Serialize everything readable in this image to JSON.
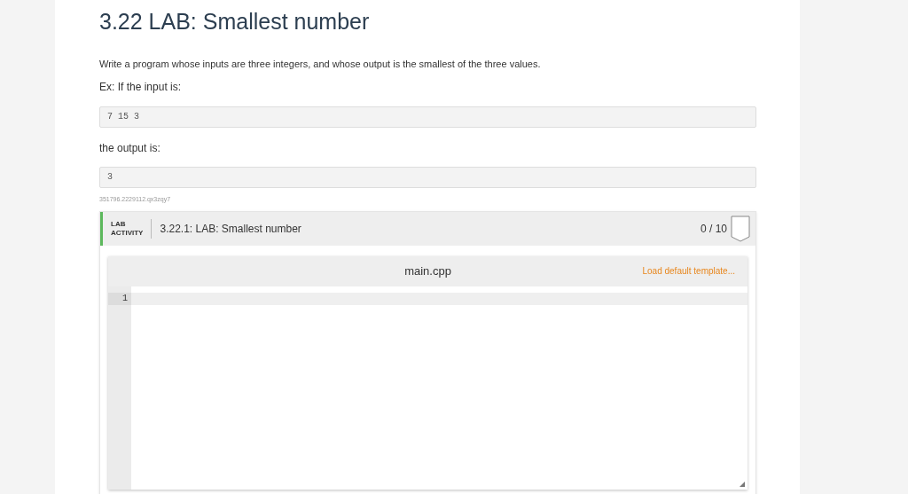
{
  "title": "3.22 LAB: Smallest number",
  "paragraphs": [
    "Write a program whose inputs are three integers, and whose output is the smallest of the three values.",
    "Ex: If the input is:"
  ],
  "input_example": "7 15 3",
  "output_label": "the output is:",
  "output_example": "3",
  "id_text": "351796.2229112.qx3zqy7",
  "lab": {
    "badge": [
      "LAB",
      "ACTIVITY"
    ],
    "title": "3.22.1: LAB: Smallest number",
    "score": "0 / 10",
    "editor": {
      "filename": "main.cpp",
      "template_link": "Load default template...",
      "line_numbers": [
        "1"
      ]
    }
  }
}
